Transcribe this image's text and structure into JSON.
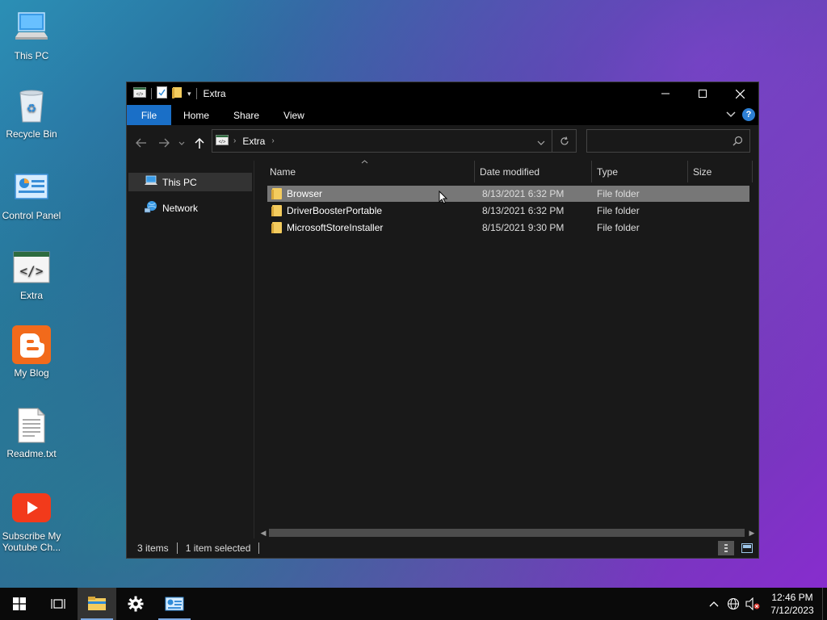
{
  "desktop": {
    "icons": [
      {
        "label": "This PC",
        "icon": "computer-icon"
      },
      {
        "label": "Recycle Bin",
        "icon": "recycle-bin-icon"
      },
      {
        "label": "Control Panel",
        "icon": "control-panel-icon"
      },
      {
        "label": "Extra",
        "icon": "code-folder-icon"
      },
      {
        "label": "My Blog",
        "icon": "blogger-icon"
      },
      {
        "label": "Readme.txt",
        "icon": "text-file-icon"
      },
      {
        "label": "Subscribe My Youtube Ch...",
        "icon": "youtube-icon"
      }
    ]
  },
  "window": {
    "title": "Extra",
    "ribbon_tabs": [
      "File",
      "Home",
      "Share",
      "View"
    ],
    "address": {
      "segments": [
        "Extra"
      ]
    },
    "search": {
      "placeholder": ""
    },
    "nav_pane": [
      {
        "label": "This PC",
        "icon": "computer-icon",
        "selected": true
      },
      {
        "label": "Network",
        "icon": "network-icon",
        "selected": false
      }
    ],
    "columns": [
      "Name",
      "Date modified",
      "Type",
      "Size"
    ],
    "files": [
      {
        "name": "Browser",
        "date": "8/13/2021 6:32 PM",
        "type": "File folder",
        "size": "",
        "selected": true
      },
      {
        "name": "DriverBoosterPortable",
        "date": "8/13/2021 6:32 PM",
        "type": "File folder",
        "size": "",
        "selected": false
      },
      {
        "name": "MicrosoftStoreInstaller",
        "date": "8/15/2021 9:30 PM",
        "type": "File folder",
        "size": "",
        "selected": false
      }
    ],
    "status": {
      "items": "3 items",
      "selected": "1 item selected"
    }
  },
  "taskbar": {
    "apps": [
      "start-icon",
      "task-view-icon",
      "file-explorer-icon",
      "settings-icon",
      "control-panel-icon"
    ],
    "clock": {
      "time": "12:46 PM",
      "date": "7/12/2023"
    }
  },
  "colors": {
    "accent": "#1a6fc7",
    "folder": "#f4cc5e",
    "selection": "#777777"
  }
}
